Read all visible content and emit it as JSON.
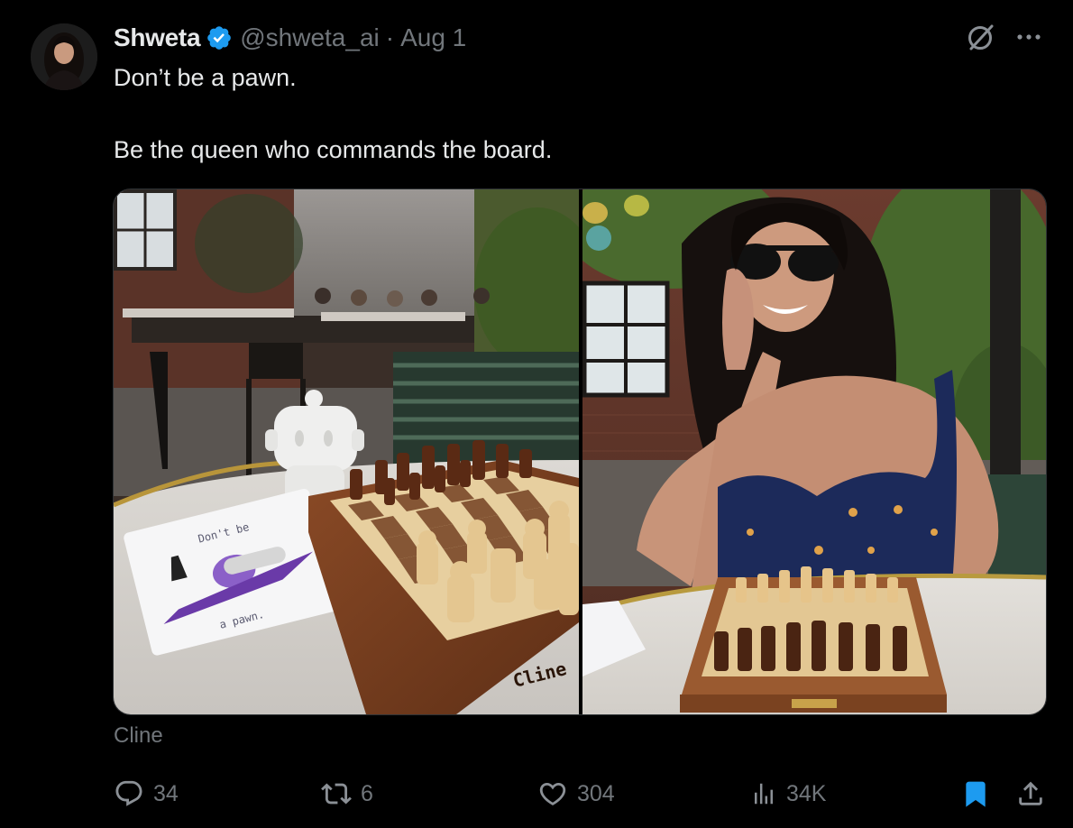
{
  "author": {
    "name": "Shweta",
    "handle": "@shweta_ai",
    "separator": "·",
    "date": "Aug 1",
    "verified": true
  },
  "tweet": {
    "line1": "Don’t be a pawn.",
    "line2": "Be the queen who commands the board."
  },
  "media": {
    "left_photo": {
      "card_text_top": "Don't be",
      "card_text_bottom": "a pawn.",
      "board_brand": "Cline"
    },
    "right_photo": {}
  },
  "source_label": "Cline",
  "actions": {
    "replies": "34",
    "reposts": "6",
    "likes": "304",
    "views": "34K"
  },
  "colors": {
    "background": "#000000",
    "text": "#e7e9ea",
    "muted": "#71767b",
    "verified": "#1d9bf0",
    "bookmark_active": "#1d9bf0"
  },
  "icons": {
    "verified": "verified-badge-icon",
    "grok": "grok-icon",
    "more": "more-icon",
    "reply": "reply-icon",
    "repost": "repost-icon",
    "like": "heart-icon",
    "views": "views-icon",
    "bookmark": "bookmark-icon",
    "share": "share-icon"
  }
}
